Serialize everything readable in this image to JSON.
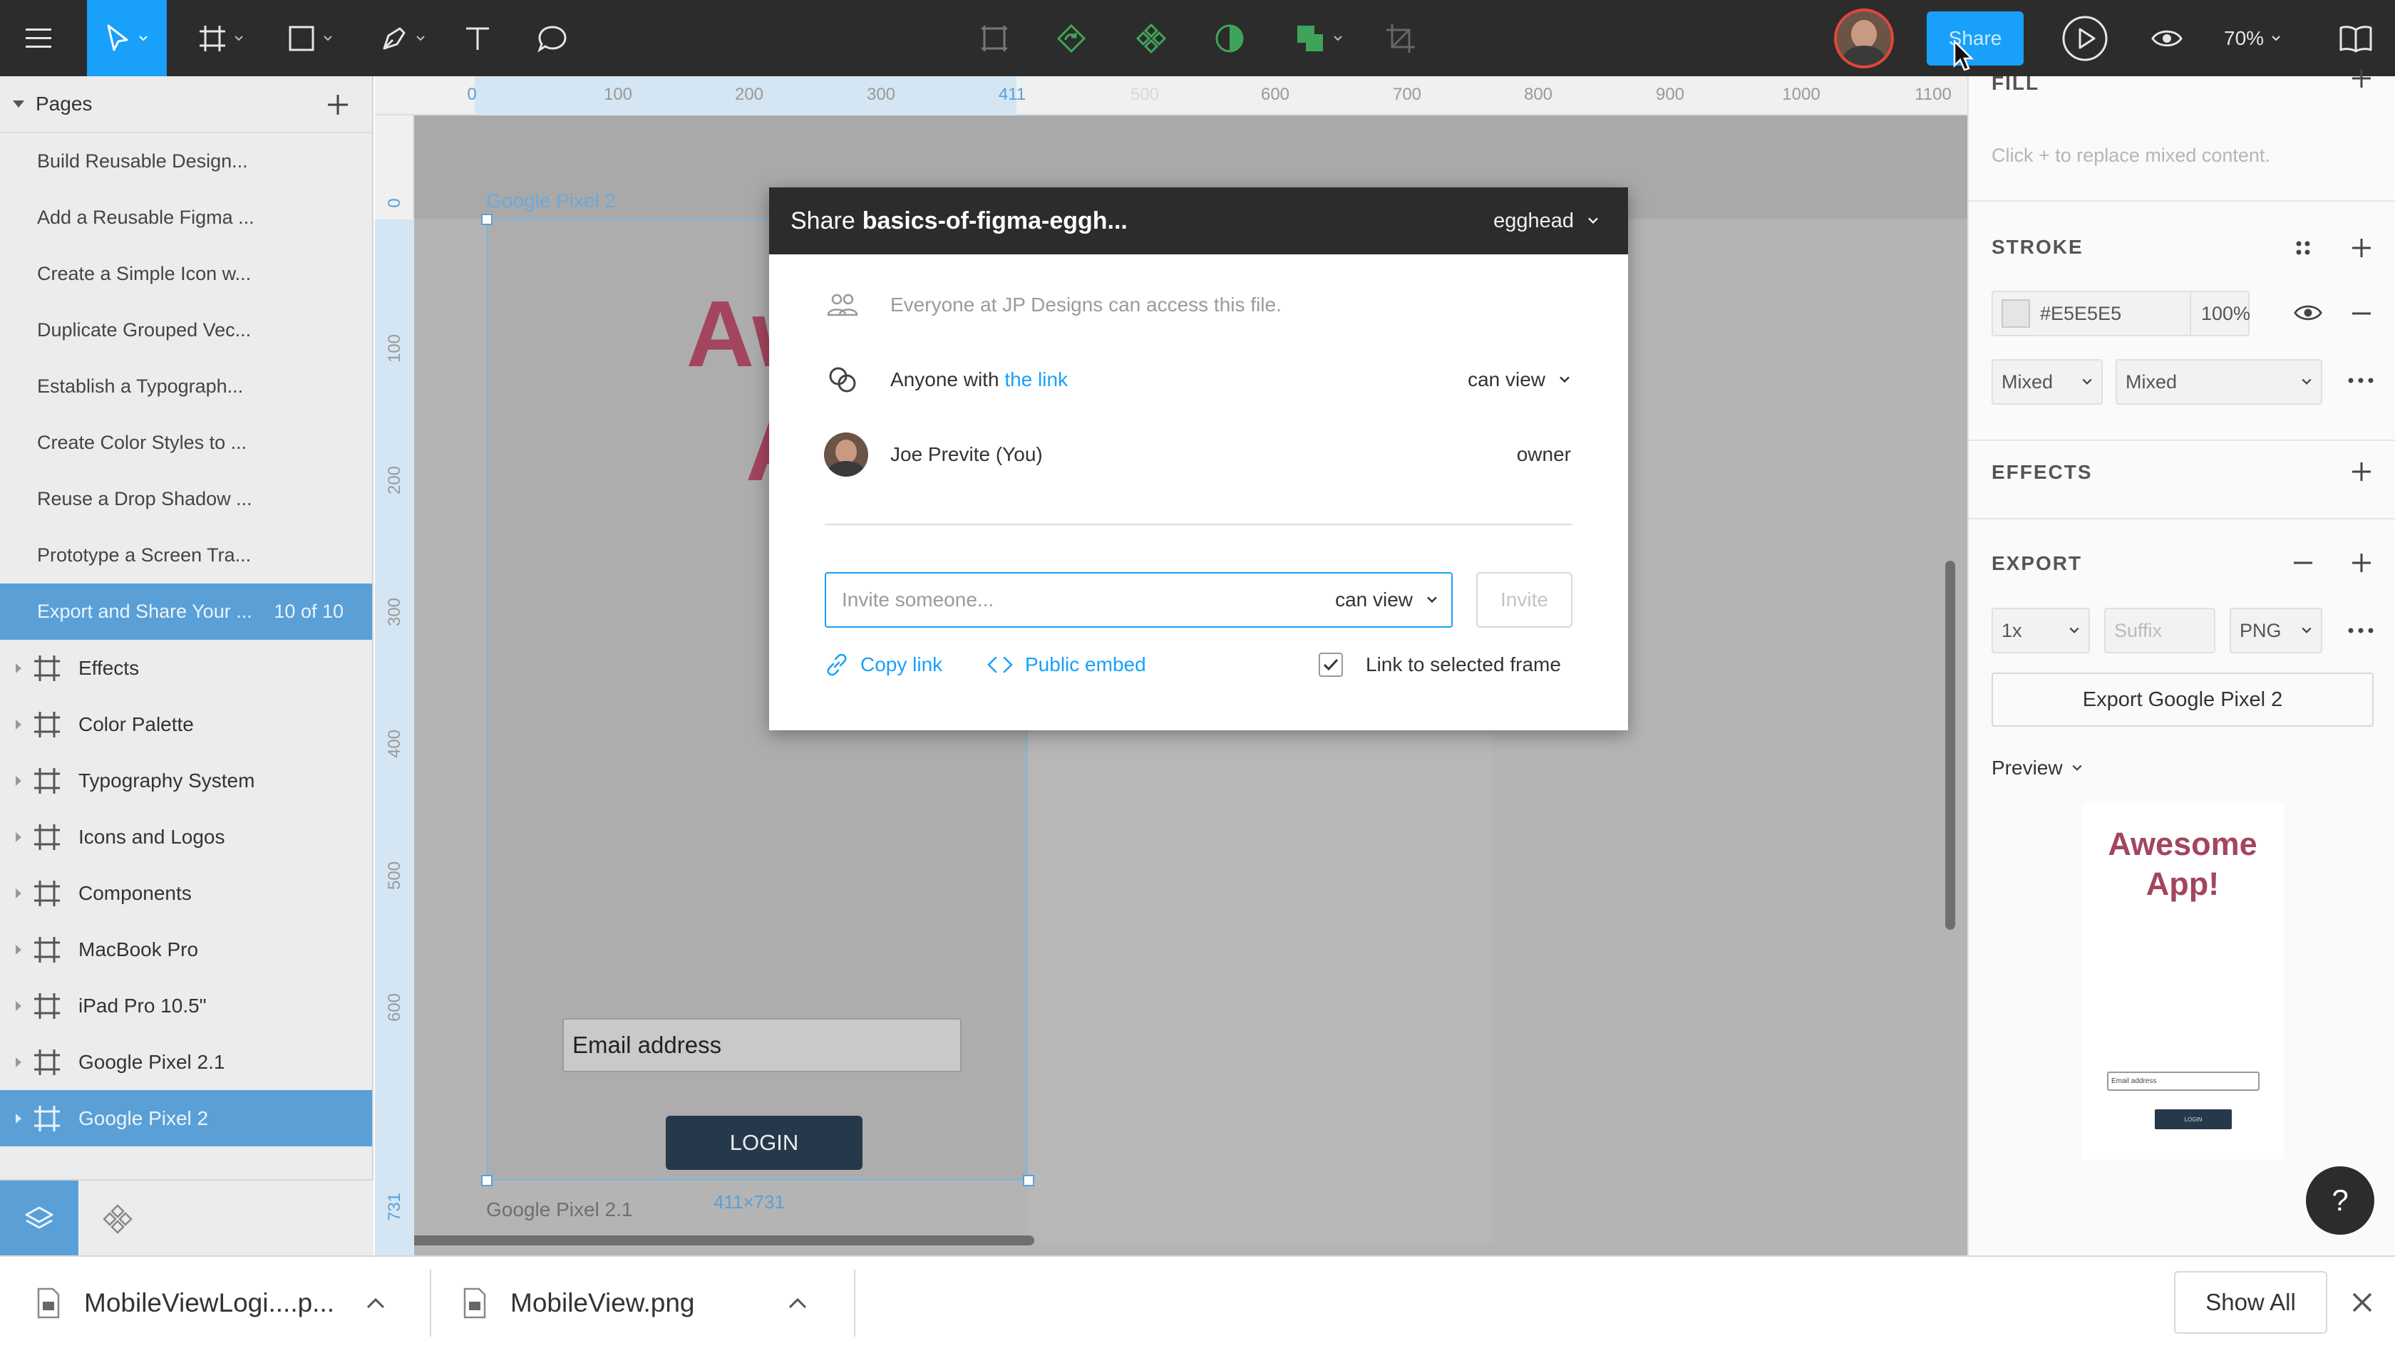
{
  "toolbar": {
    "share_label": "Share",
    "zoom": "70%"
  },
  "left_panel": {
    "pages_title": "Pages",
    "pages": [
      {
        "label": "Build Reusable Design..."
      },
      {
        "label": "Add a Reusable Figma ..."
      },
      {
        "label": "Create a Simple Icon w..."
      },
      {
        "label": "Duplicate Grouped Vec..."
      },
      {
        "label": "Establish a Typograph..."
      },
      {
        "label": "Create Color Styles to ..."
      },
      {
        "label": "Reuse a Drop Shadow ..."
      },
      {
        "label": "Prototype a Screen Tra..."
      },
      {
        "label": "Export and Share Your ...",
        "count": "10 of 10"
      }
    ],
    "layers": [
      {
        "label": "Effects"
      },
      {
        "label": "Color Palette"
      },
      {
        "label": "Typography System"
      },
      {
        "label": "Icons and Logos"
      },
      {
        "label": "Components"
      },
      {
        "label": "MacBook Pro"
      },
      {
        "label": "iPad Pro 10.5\""
      },
      {
        "label": "Google Pixel 2.1"
      },
      {
        "label": "Google Pixel 2"
      }
    ]
  },
  "rulers": {
    "top": [
      "0",
      "100",
      "200",
      "300",
      "411",
      "500",
      "600",
      "700",
      "800",
      "900",
      "1000",
      "1100"
    ],
    "left": [
      "0",
      "100",
      "200",
      "300",
      "400",
      "500",
      "600",
      "731"
    ]
  },
  "canvas": {
    "frame_label_gp2": "Google Pixel 2",
    "frame_label_gp21": "Google Pixel 2.1",
    "headline_line1": "Awes",
    "headline_line2": "Ap",
    "email_placeholder": "Email address",
    "login_label": "LOGIN",
    "dimensions": "411×731"
  },
  "share_dialog": {
    "title_prefix": "Share",
    "file_name": "basics-of-figma-eggh...",
    "team": "egghead",
    "org_access": "Everyone at JP Designs can access this file.",
    "link_prefix": "Anyone with",
    "link_word": "the link",
    "link_permission": "can view",
    "user_name": "Joe Previte (You)",
    "user_role": "owner",
    "invite_placeholder": "Invite someone...",
    "invite_permission": "can view",
    "invite_button": "Invite",
    "copy_link": "Copy link",
    "public_embed": "Public embed",
    "link_selected_frame": "Link to selected frame",
    "link_selected_frame_checked": true
  },
  "right_panel": {
    "fill_title": "FILL",
    "fill_hint": "Click + to replace mixed content.",
    "stroke_title": "STROKE",
    "stroke_color": "#E5E5E5",
    "stroke_opacity": "100%",
    "stroke_align": "Mixed",
    "stroke_width": "Mixed",
    "effects_title": "EFFECTS",
    "export_title": "EXPORT",
    "export_scale": "1x",
    "export_suffix_placeholder": "Suffix",
    "export_format": "PNG",
    "export_button": "Export Google Pixel 2",
    "preview_label": "Preview",
    "preview_title": "Awesome App!",
    "preview_email": "Email address",
    "preview_login": "LOGIN",
    "help": "?"
  },
  "downloads": {
    "items": [
      {
        "name": "MobileViewLogi....p..."
      },
      {
        "name": "MobileView.png"
      }
    ],
    "show_all": "Show All"
  },
  "colors": {
    "accent": "#18a0fb",
    "selection": "#5aa0d7",
    "toolbar_bg": "#2c2c2c",
    "headline": "#a3455e",
    "login_button": "#26394a"
  }
}
